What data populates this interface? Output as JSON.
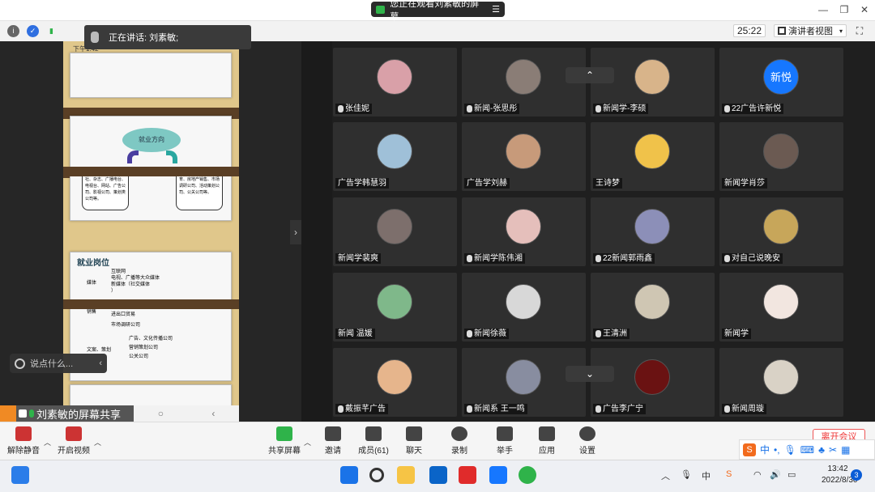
{
  "window": {
    "sharing_banner": "您正在观看刘素敏的屏幕"
  },
  "topbar": {
    "timer": "25:22",
    "view_mode": "演讲者视图"
  },
  "talking": {
    "label": "正在讲话: 刘素敏;"
  },
  "shared_screen": {
    "status_time": "下午1:42",
    "slide2": {
      "center": "就业方向",
      "left_box": "互联网及媒体行业 报社、杂志、广播电台、电视台、网站、广告公司、影视公司、策划类公司等。",
      "right_box": "市场调查销售行业 教育、房地产销售、市场调研公司、活动策划公司、公关公司等。"
    },
    "slide3": {
      "title": "就业岗位",
      "cat1": "媒体",
      "cat1_items": "互联网\n电视、广播等大众媒体\n新媒体（社交媒体\n）",
      "cat2": "销售",
      "cat2_items": "房地产及各行业销售\n进出口贸易\n市场调研公司",
      "cat3": "文案、策划",
      "cat3_items": "广告、文化传播公司\n营销策划公司\n公关公司"
    }
  },
  "chat": {
    "placeholder": "说点什么..."
  },
  "share_label": "刘素敏的屏幕共享",
  "participants": [
    {
      "name": "张佳妮",
      "mic": true,
      "color": "#d9a0a8"
    },
    {
      "name": "新闻-张思彤",
      "mic": true,
      "color": "#8a7d76"
    },
    {
      "name": "新闻学-李硕",
      "mic": true,
      "color": "#d8b48a"
    },
    {
      "name": "22广告许新悦",
      "mic": true,
      "avatar_text": "新悦",
      "color": "#1677ff"
    },
    {
      "name": "广告学韩慧羽",
      "mic": false,
      "color": "#9fc0d8"
    },
    {
      "name": "广告学刘赫",
      "mic": false,
      "color": "#c79a7a"
    },
    {
      "name": "王诗梦",
      "mic": false,
      "color": "#f0c24a"
    },
    {
      "name": "新闻学肖莎",
      "mic": false,
      "color": "#6b5a52"
    },
    {
      "name": "新闻学裴爽",
      "mic": false,
      "color": "#7d6f6c"
    },
    {
      "name": "新闻学陈伟湘",
      "mic": true,
      "color": "#e5bfbb"
    },
    {
      "name": "22新闻郭雨鑫",
      "mic": true,
      "color": "#8c8fb8"
    },
    {
      "name": "对自己说晚安",
      "mic": true,
      "color": "#c7a65a"
    },
    {
      "name": "新闻 温媛",
      "mic": false,
      "color": "#7fb88a"
    },
    {
      "name": "新闻徐薇",
      "mic": true,
      "color": "#d8d8d8"
    },
    {
      "name": "王清洲",
      "mic": true,
      "color": "#cfc6b3"
    },
    {
      "name": "新闻学",
      "mic": false,
      "color": "#f2e6e0"
    },
    {
      "name": "戴振芊广告",
      "mic": true,
      "color": "#e6b58c"
    },
    {
      "name": "新闻系 王一鸣",
      "mic": true,
      "color": "#888da0"
    },
    {
      "name": "广告李广宁",
      "mic": true,
      "color": "#6a1212"
    },
    {
      "name": "新闻周璇",
      "mic": true,
      "color": "#d9d2c6"
    }
  ],
  "controls": {
    "unmute": "解除静音",
    "video": "开启视频",
    "share": "共享屏幕",
    "invite": "邀请",
    "members": "成员(61)",
    "chat": "聊天",
    "record": "录制",
    "raise_hand": "举手",
    "apps": "应用",
    "settings": "设置",
    "leave": "离开会议"
  },
  "ime": {
    "lang": "中"
  },
  "taskbar": {
    "time": "13:42",
    "date": "2022/8/30",
    "notifications": "3"
  }
}
